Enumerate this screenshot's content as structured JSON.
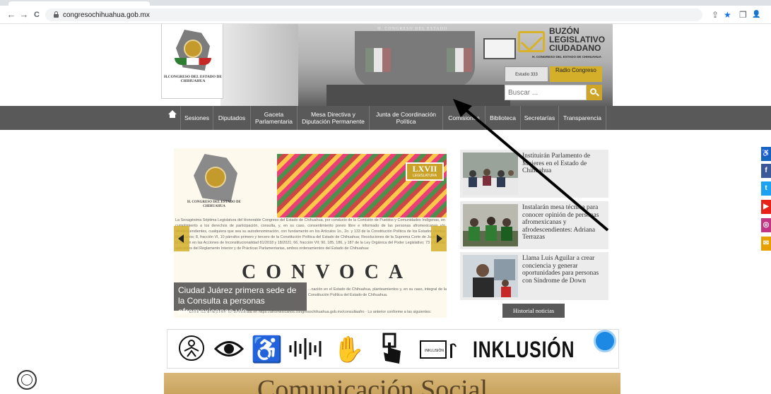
{
  "browser": {
    "url": "congresochihuahua.gob.mx",
    "back_icon": "←",
    "forward_icon": "→",
    "reload_icon": "C",
    "share_icon": "⇪",
    "star_icon": "★",
    "panel_icon": "❐",
    "profile_icon": "👤"
  },
  "header": {
    "logo_text": "H.CONGRESO DEL ESTADO DE CHIHUAHUA",
    "hero_plaque": "H. CONGRESO DEL ESTADO",
    "buzon": {
      "line1": "BUZÓN",
      "line2": "LEGISLATIVO",
      "line3": "CIUDADANO",
      "sub": "H. CONGRESO DEL ESTADO DE CHIHUAHUA"
    },
    "radio": {
      "estudio": "Estudio 333",
      "label": "Radio Congreso"
    },
    "search": {
      "placeholder": "Buscar ..."
    }
  },
  "nav": {
    "home_icon": "home-icon",
    "items": [
      {
        "label": "Sesiones"
      },
      {
        "label": "Diputados"
      },
      {
        "label": "Gaceta Parlamentaria"
      },
      {
        "label": "Mesa Directiva y Diputación Permanente"
      },
      {
        "label": "Junta de Coordinación Política"
      },
      {
        "label": "Comisiones"
      },
      {
        "label": "Biblioteca"
      },
      {
        "label": "Secretarías"
      },
      {
        "label": "Transparencia"
      }
    ]
  },
  "slider": {
    "org": "H. CONGRESO DEL ESTADO DE CHIHUAHUA",
    "badge": "LXVII",
    "badge_sub": "LEGISLATURA",
    "body": "La Sexagésima Séptima Legislatura del Honorable Congreso del Estado de Chihuahua, por conducto de la Comisión de Pueblos y Comunidades Indígenas, en cumplimiento a los derechos de participación, consulta, y, en su caso, consentimiento previo libre e informado de las personas afromexicanas y/o afrodescendientes, cualquiera que sea su autodenominación, con fundamento en los Artículos 1o., 2o. y 133 de la Constitución Política de los Estados Unidos Mexicanos; 8, fracción VI, 10 párrafos primero y tercero de la Constitución Política del Estado de Chihuahua; Resoluciones de la Suprema Corte de Justicia de la Nación en las Acciones de Inconstitucionalidad 81/2018 y 18/2021; 66, fracción VII; 90, 185, 186, y 187 de la Ley Orgánica del Poder Legislativo; 73 y demás aplicables del Reglamento Interior y de Prácticas Parlamentarias, ambos ordenamientos del Estado de Chihuahua:",
    "convoca": "CONVOCA",
    "foot": "...nación en el Estado de Chihuahua, planteamientos y, en su caso, integral de la Constitución Política del Estado de Chihuahua.",
    "foot2": "Dicha iniciativa puede ser consultada en https://afromexicanos.congresochihuahua.gob.mx/consultaafro · Lo anterior conforme a las siguientes:",
    "caption": "Ciudad Juárez primera sede de la Consulta a personas afromexicanas y/o afrodescendientes"
  },
  "news": [
    {
      "title": "Instituirán Parlamento de Mujeres en el Estado de Chihuahua"
    },
    {
      "title": "Instalarán mesa técnica para conocer opinión de personas afromexicanas y afrodescendientes: Adriana Terrazas"
    },
    {
      "title": "Llama Luis Aguilar a crear conciencia y generar oportunidades para personas con Síndrome de Down"
    }
  ],
  "historial_label": "Historial noticias",
  "inklusion": {
    "word": "INKLUSIÓN",
    "mini_logo": "INKLUSIÓN"
  },
  "comsoc_title": "Comunicación Social",
  "social": [
    {
      "name": "accessibility-icon",
      "glyph": "♿",
      "color": "#1565c0"
    },
    {
      "name": "facebook-icon",
      "glyph": "f",
      "color": "#3b5998"
    },
    {
      "name": "twitter-icon",
      "glyph": "t",
      "color": "#1da1f2"
    },
    {
      "name": "youtube-icon",
      "glyph": "▶",
      "color": "#e62117"
    },
    {
      "name": "instagram-icon",
      "glyph": "◎",
      "color": "#c13584"
    },
    {
      "name": "mail-icon",
      "glyph": "✉",
      "color": "#e6a100"
    }
  ],
  "colors": {
    "nav_bg": "#595959",
    "accent_gold": "#cfa527"
  }
}
